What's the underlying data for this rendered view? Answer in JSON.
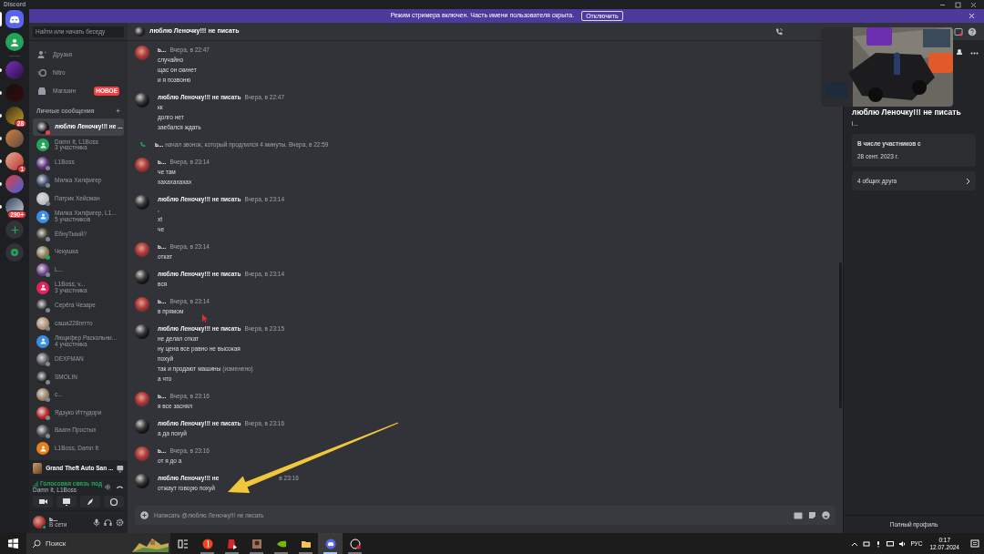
{
  "window": {
    "title": "Discord"
  },
  "banner": {
    "text": "Режим стримера включен. Часть имени пользователя скрыта.",
    "button": "Отключить"
  },
  "servers": [
    {
      "kind": "home",
      "selected": true
    },
    {
      "kind": "dm",
      "selected": false,
      "unread": false
    },
    {
      "kind": "server",
      "selected": false,
      "unread": true
    },
    {
      "kind": "server",
      "selected": false,
      "unread": true
    },
    {
      "kind": "server",
      "selected": false,
      "unread": true,
      "badge": "28"
    },
    {
      "kind": "server",
      "selected": false,
      "unread": true
    },
    {
      "kind": "server",
      "selected": false,
      "unread": true,
      "badge": "1"
    },
    {
      "kind": "server",
      "selected": false,
      "unread": true
    },
    {
      "kind": "server",
      "selected": false,
      "unread": true,
      "badge": "290+"
    },
    {
      "kind": "add",
      "selected": false
    },
    {
      "kind": "explore",
      "selected": false
    }
  ],
  "sidebar": {
    "search": "Найти или начать беседу",
    "nav": [
      {
        "kind": "friends",
        "label": "Друзья"
      },
      {
        "kind": "nitro",
        "label": "Nitro"
      },
      {
        "kind": "shop",
        "label": "Магазин",
        "badge": "НОВОЕ"
      }
    ],
    "section": "Личные сообщения",
    "dms": [
      {
        "kind": "user",
        "name": "люблю Леночку!!! не ...",
        "selected": true,
        "color": "#f23f43"
      },
      {
        "kind": "group",
        "name": "Damn It, L1Boss",
        "subtitle": "3 участника",
        "selected": false
      },
      {
        "kind": "user",
        "name": "L1Boss",
        "selected": false,
        "color": "#80848e"
      },
      {
        "kind": "user",
        "name": "Милка Хилфигер",
        "selected": false,
        "color": "#80848e"
      },
      {
        "kind": "user",
        "name": "Патрик Хейсман",
        "selected": false,
        "color": "#80848e"
      },
      {
        "kind": "group",
        "name": "Милка Хилфигер, L1...",
        "subtitle": "5 участников",
        "selected": false
      },
      {
        "kind": "user",
        "name": "ЁбнуТыый?",
        "selected": false,
        "color": "#80848e"
      },
      {
        "kind": "user",
        "name": "Чекушка",
        "selected": false,
        "color": "#23a559"
      },
      {
        "kind": "user",
        "name": "L...",
        "selected": false,
        "color": "#80848e"
      },
      {
        "kind": "group",
        "name": "L1Boss, v...",
        "subtitle": "3 участника",
        "selected": false
      },
      {
        "kind": "user",
        "name": "Серёга Чезаре",
        "selected": false,
        "color": "#80848e"
      },
      {
        "kind": "user",
        "name": "саша228гетто",
        "selected": false,
        "color": "#80848e"
      },
      {
        "kind": "group",
        "name": "Люцифер Раскольни...",
        "subtitle": "4 участника",
        "selected": false
      },
      {
        "kind": "user",
        "name": "DEXFMAN",
        "selected": false,
        "color": "#80848e"
      },
      {
        "kind": "user",
        "name": "SMOLIN",
        "selected": false,
        "color": "#80848e"
      },
      {
        "kind": "user",
        "name": "с...",
        "selected": false,
        "color": "#80848e"
      },
      {
        "kind": "user",
        "name": "Ядзуко Иттудори",
        "selected": false,
        "color": "#80848e"
      },
      {
        "kind": "user",
        "name": "Ваагн Простых",
        "selected": false,
        "color": "#80848e"
      },
      {
        "kind": "group",
        "name": "L1Boss, Damn It",
        "selected": false
      }
    ],
    "activity": "Grand Theft Auto San ...",
    "voice": {
      "status": "Голосовая связь под",
      "channel": "Damn It, L1Boss"
    },
    "user": {
      "name": "ь...",
      "status": "В сети"
    }
  },
  "chat": {
    "title": "люблю Леночку!!! не писать",
    "messages": [
      {
        "kind": "self",
        "author": "ь...",
        "time": "Вчера, в 22:47",
        "lines": [
          {
            "text": "случайно"
          },
          {
            "text": "щас он скинет"
          },
          {
            "text": "и я позвоню"
          }
        ]
      },
      {
        "kind": "friend",
        "author": "люблю Леночку!!! не писать",
        "time": "Вчера, в 22:47",
        "lines": [
          {
            "text": "кк"
          },
          {
            "text": "долго нет"
          },
          {
            "text": "заебался ждать"
          }
        ]
      },
      {
        "kind": "call",
        "author": "ь...",
        "text": "начал звонок, который продлился 4 минуты.",
        "time": "Вчера, в 22:59"
      },
      {
        "kind": "self",
        "author": "ь...",
        "time": "Вчера, в 23:14",
        "lines": [
          {
            "text": "че там"
          },
          {
            "text": "хахахахахах"
          }
        ]
      },
      {
        "kind": "friend",
        "author": "люблю Леночку!!! не писать",
        "time": "Вчера, в 23:14",
        "lines": [
          {
            "text": ","
          },
          {
            "text": "xt"
          },
          {
            "text": "че"
          }
        ]
      },
      {
        "kind": "self",
        "author": "ь...",
        "time": "Вчера, в 23:14",
        "lines": [
          {
            "text": "откат"
          }
        ]
      },
      {
        "kind": "friend",
        "author": "люблю Леночку!!! не писать",
        "time": "Вчера, в 23:14",
        "lines": [
          {
            "text": "вся"
          }
        ]
      },
      {
        "kind": "self",
        "author": "ь...",
        "time": "Вчера, в 23:14",
        "lines": [
          {
            "text": "в прямом"
          }
        ]
      },
      {
        "kind": "friend",
        "author": "люблю Леночку!!! не писать",
        "time": "Вчера, в 23:15",
        "lines": [
          {
            "text": "не делал откат"
          },
          {
            "text": "ну цена все равно не высокая"
          },
          {
            "text": "похуй"
          },
          {
            "text": "так и продают машины",
            "edited": "(изменено)"
          },
          {
            "text": "а что"
          }
        ]
      },
      {
        "kind": "self",
        "author": "ь...",
        "time": "Вчера, в 23:16",
        "lines": [
          {
            "text": "я все заснял"
          }
        ]
      },
      {
        "kind": "friend",
        "author": "люблю Леночку!!! не писать",
        "time": "Вчера, в 23:16",
        "lines": [
          {
            "text": "а да похуй"
          }
        ]
      },
      {
        "kind": "self",
        "author": "ь...",
        "time": "Вчера, в 23:16",
        "lines": [
          {
            "text": "от я до а"
          }
        ]
      },
      {
        "kind": "friend",
        "author": "люблю Леночку!!! не",
        "time": "в 23:16",
        "covered": true,
        "lines": [
          {
            "text": "отжаут говорю похуй"
          }
        ]
      }
    ],
    "composer": {
      "placeholder": "Написать @люблю Леночку!!! не писать"
    }
  },
  "profile": {
    "name": "люблю Леночку!!! не писать",
    "tag": "i...",
    "member_since_label": "В числе участников с",
    "member_since": "28 сент. 2023 г.",
    "mutual": "4 общих друга",
    "full_profile": "Полный профиль"
  },
  "taskbar": {
    "search": "Поиск",
    "language": "РУС",
    "time": "0:17",
    "date": "12.07.2024"
  }
}
